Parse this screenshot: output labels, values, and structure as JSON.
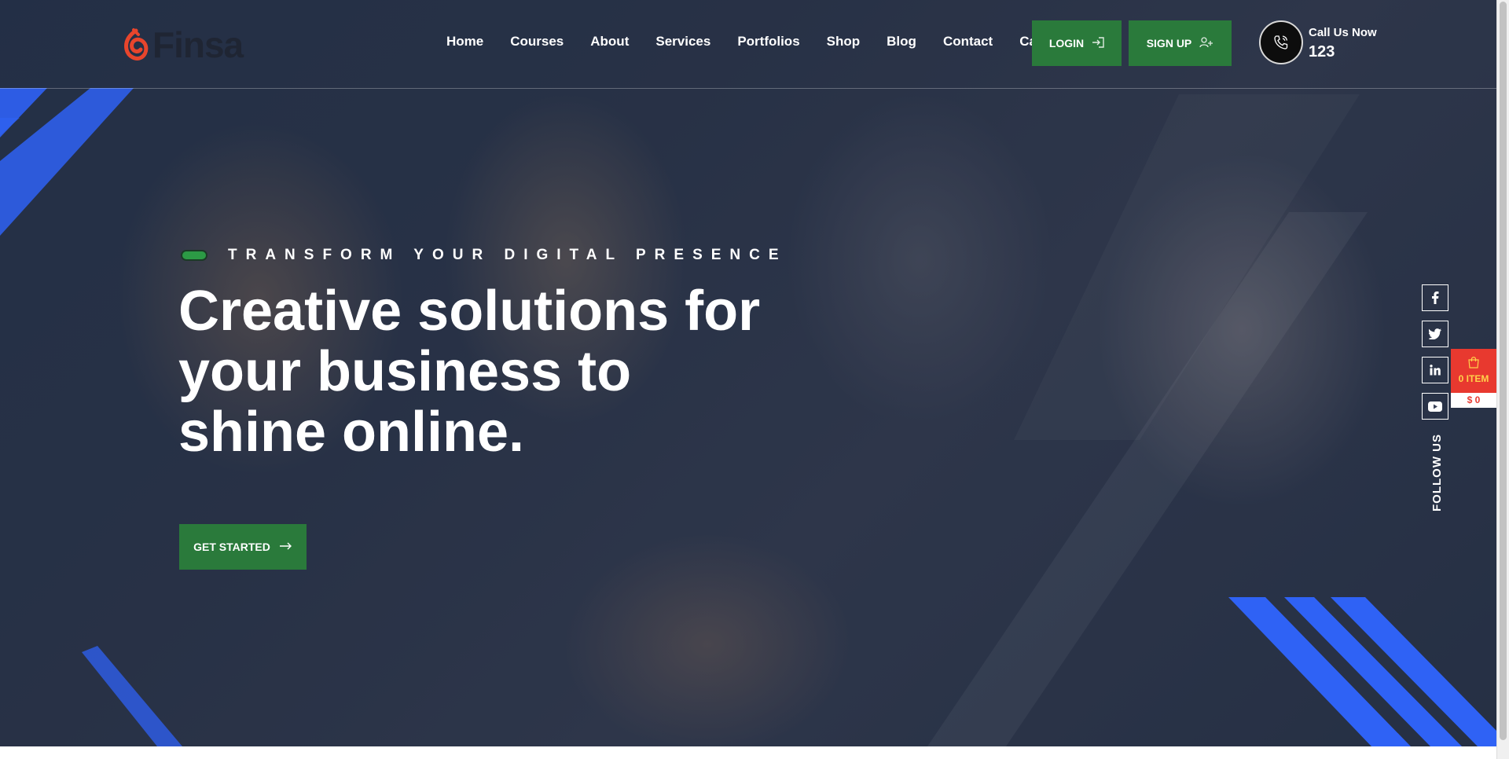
{
  "brand": {
    "name": "Finsa",
    "logo_color": "#e8452c"
  },
  "nav": {
    "items": [
      "Home",
      "Courses",
      "About",
      "Services",
      "Portfolios",
      "Shop",
      "Blog",
      "Contact",
      "Cart"
    ]
  },
  "auth": {
    "login_label": "LOGIN",
    "signup_label": "SIGN UP"
  },
  "call": {
    "label": "Call Us Now",
    "number": "123"
  },
  "hero": {
    "tagline": "TRANSFORM YOUR DIGITAL PRESENCE",
    "headline": "Creative solutions for your business to shine online.",
    "cta_label": "GET STARTED"
  },
  "social": {
    "items": [
      "facebook-icon",
      "twitter-icon",
      "linkedin-icon",
      "youtube-icon"
    ],
    "follow_label": "FOLLOW US"
  },
  "cart_widget": {
    "items_label": "0 ITEM",
    "total": "$ 0"
  },
  "colors": {
    "accent_green": "#2a7a3b",
    "stripe_blue": "#2f62f5",
    "cart_red": "#e8392f"
  }
}
